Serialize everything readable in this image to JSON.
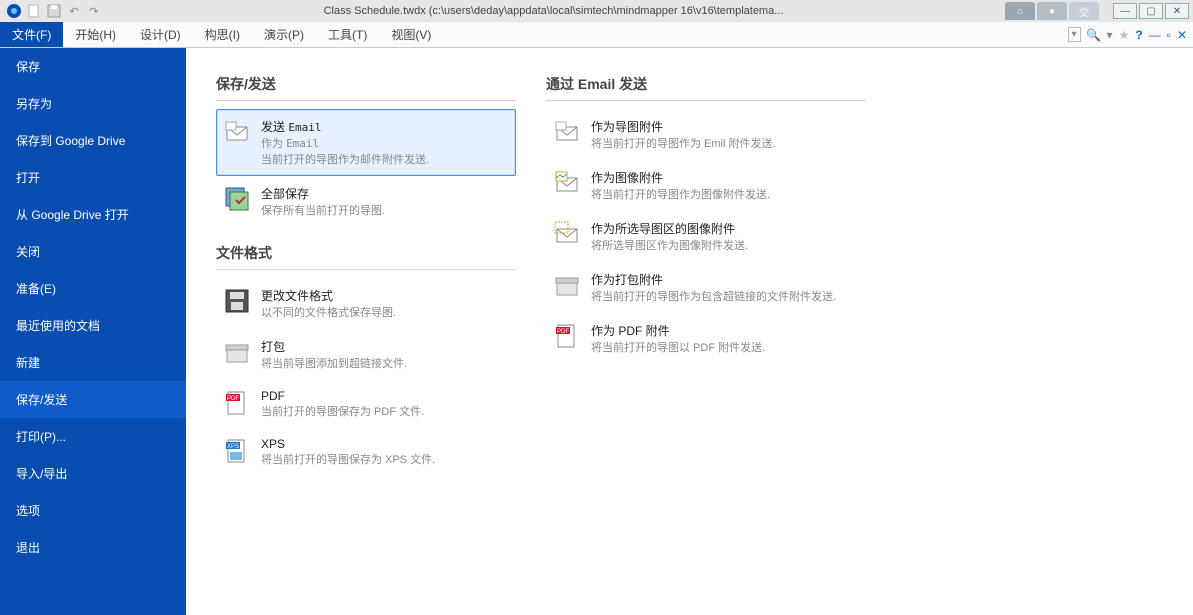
{
  "titlebar": {
    "title": "Class Schedule.twdx (c:\\users\\deday\\appdata\\local\\simtech\\mindmapper 16\\v16\\templatema..."
  },
  "ribbon": {
    "file": "文件(F)",
    "tabs": [
      "开始(H)",
      "设计(D)",
      "构思(I)",
      "演示(P)",
      "工具(T)",
      "视图(V)"
    ]
  },
  "sidebar": {
    "items": [
      "保存",
      "另存为",
      "保存到 Google Drive",
      "打开",
      "从 Google Drive 打开",
      "关闭",
      "准备(E)",
      "最近使用的文档",
      "新建",
      "保存/发送",
      "打印(P)...",
      "导入/导出",
      "选项",
      "退出"
    ],
    "selected": "保存/发送"
  },
  "content": {
    "left": {
      "section1": "保存/发送",
      "opt1": {
        "t1a": "发送",
        "t1b": "Email",
        "t2a": "作为",
        "t2b": "Email",
        "t3": "当前打开的导图作为邮件附件发送."
      },
      "opt2": {
        "t1": "全部保存",
        "t2": "保存所有当前打开的导图."
      },
      "section2": "文件格式",
      "opt3": {
        "t1": "更改文件格式",
        "t2": "以不同的文件格式保存导图."
      },
      "opt4": {
        "t1": "打包",
        "t2": "将当前导图添加到超链接文件."
      },
      "opt5": {
        "t1": "PDF",
        "t2": "当前打开的导图保存为 PDF 文件."
      },
      "opt6": {
        "t1": "XPS",
        "t2": "将当前打开的导图保存为 XPS 文件."
      }
    },
    "right": {
      "section1": "通过 Email 发送",
      "opt1": {
        "t1": "作为导图附件",
        "t2": "将当前打开的导图作为 Emil 附件发送."
      },
      "opt2": {
        "t1": "作为图像附件",
        "t2": "将当前打开的导图作为图像附件发送."
      },
      "opt3": {
        "t1": "作为所选导图区的图像附件",
        "t2": "将所选导图区作为图像附件发送."
      },
      "opt4": {
        "t1": "作为打包附件",
        "t2": "将当前打开的导图作为包含超链接的文件附件发送."
      },
      "opt5": {
        "t1": "作为 PDF 附件",
        "t2": "将当前打开的导图以 PDF 附件发送."
      }
    }
  }
}
